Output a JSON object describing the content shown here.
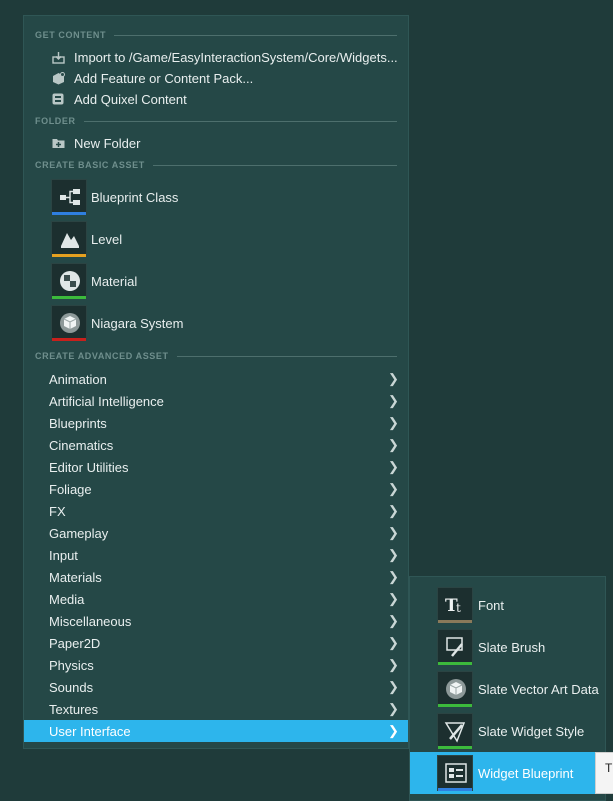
{
  "context_menu": {
    "sections": {
      "get_content": "GET CONTENT",
      "folder": "FOLDER",
      "create_basic_asset": "CREATE BASIC ASSET",
      "create_advanced_asset": "CREATE ADVANCED ASSET"
    },
    "get_content_items": [
      {
        "label": "Import to /Game/EasyInteractionSystem/Core/Widgets...",
        "icon": "import-icon"
      },
      {
        "label": "Add Feature or Content Pack...",
        "icon": "feature-pack-icon"
      },
      {
        "label": "Add Quixel Content",
        "icon": "quixel-icon"
      }
    ],
    "folder_items": [
      {
        "label": "New Folder",
        "icon": "new-folder-icon"
      }
    ],
    "basic_assets": [
      {
        "label": "Blueprint Class",
        "icon": "blueprint-class-icon",
        "color": "#2f7fe0"
      },
      {
        "label": "Level",
        "icon": "level-icon",
        "color": "#e5a020"
      },
      {
        "label": "Material",
        "icon": "material-icon",
        "color": "#3cba3c"
      },
      {
        "label": "Niagara System",
        "icon": "niagara-icon",
        "color": "#c8201c"
      }
    ],
    "advanced_assets": [
      "Animation",
      "Artificial Intelligence",
      "Blueprints",
      "Cinematics",
      "Editor Utilities",
      "Foliage",
      "FX",
      "Gameplay",
      "Input",
      "Materials",
      "Media",
      "Miscellaneous",
      "Paper2D",
      "Physics",
      "Sounds",
      "Textures",
      "User Interface"
    ],
    "active_item": "User Interface"
  },
  "user_interface_submenu": {
    "items": [
      {
        "label": "Font",
        "icon": "font-icon",
        "color": "#8a7a5a"
      },
      {
        "label": "Slate Brush",
        "icon": "slate-brush-icon",
        "color": "#3cba3c"
      },
      {
        "label": "Slate Vector Art Data",
        "icon": "slate-vector-icon",
        "color": "#3cba3c"
      },
      {
        "label": "Slate Widget Style",
        "icon": "slate-widget-style-icon",
        "color": "#3cba3c"
      },
      {
        "label": "Widget Blueprint",
        "icon": "widget-blueprint-icon",
        "color": "#2f7fe0"
      }
    ],
    "active_item": "Widget Blueprint"
  },
  "tooltip": {
    "text": "T"
  },
  "colors": {
    "accent": "#2db5ec",
    "menu_bg": "#254847",
    "page_bg": "#1f3b3a"
  }
}
